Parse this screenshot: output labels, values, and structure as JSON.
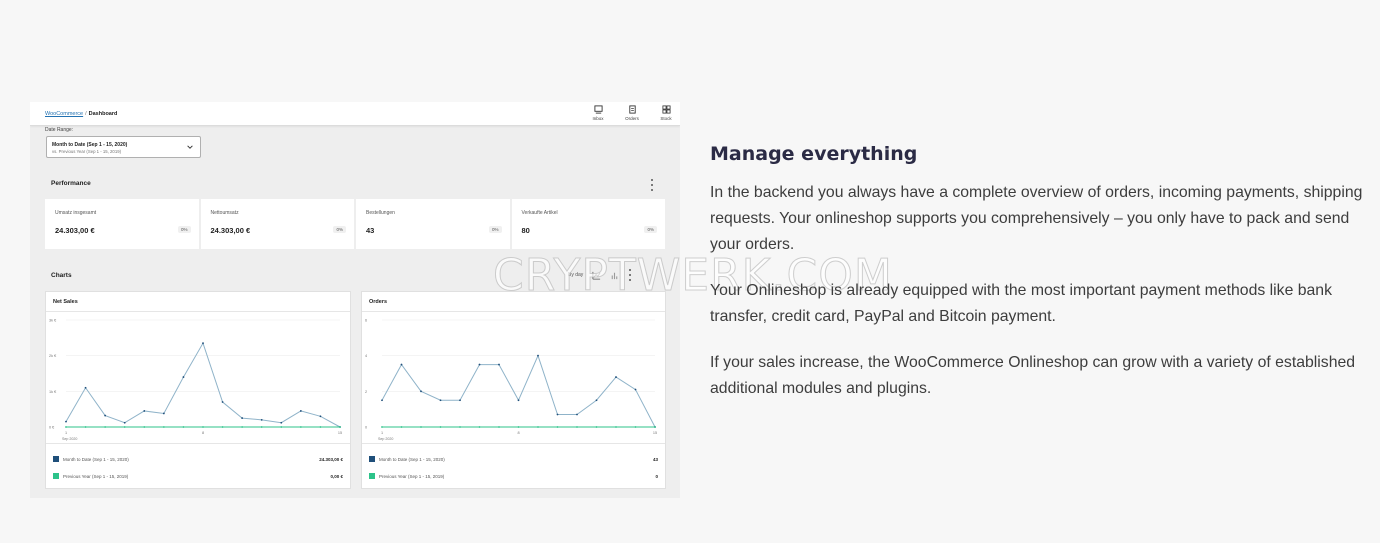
{
  "screenshot": {
    "breadcrumb": {
      "link": "WooCommerce",
      "separator": "/",
      "current": "Dashboard"
    },
    "topbar_items": [
      {
        "label": "Inbox",
        "icon": "inbox-icon"
      },
      {
        "label": "Orders",
        "icon": "orders-icon"
      },
      {
        "label": "Stock",
        "icon": "stock-icon"
      }
    ],
    "date_range": {
      "label": "Date Range:",
      "selected": "Month to Date (Sep 1 - 15, 2020)",
      "compare": "vs. Previous Year (Sep 1 - 15, 2019)"
    },
    "performance": {
      "title": "Performance",
      "cards": [
        {
          "label": "Umsatz insgesamt",
          "value": "24.303,00 €",
          "delta": "0%"
        },
        {
          "label": "Nettoumsatz",
          "value": "24.303,00 €",
          "delta": "0%"
        },
        {
          "label": "Bestellungen",
          "value": "43",
          "delta": "0%"
        },
        {
          "label": "Verkaufte Artikel",
          "value": "80",
          "delta": "0%"
        }
      ]
    },
    "charts_section": {
      "title": "Charts",
      "interval": "By day"
    },
    "colors": {
      "current": "#1f4f7a",
      "previous": "#2cc38a",
      "line": "#8fb3c9"
    }
  },
  "chart_data": [
    {
      "type": "line",
      "title": "Net Sales",
      "y_ticks": [
        "0 €",
        "1k €",
        "2k €",
        "3k €"
      ],
      "x_ticks": [
        "1",
        "8",
        "15"
      ],
      "x_sub": "Sep 2020",
      "ylim": [
        0,
        3000
      ],
      "x": [
        1,
        2,
        3,
        4,
        5,
        6,
        7,
        8,
        9,
        10,
        11,
        12,
        13,
        14,
        15
      ],
      "series": [
        {
          "name": "Month to Date (Sep 1 - 15, 2020)",
          "values": [
            150,
            1100,
            320,
            120,
            450,
            380,
            1400,
            2350,
            700,
            250,
            200,
            120,
            450,
            300,
            0
          ],
          "total": "24.303,00 €"
        },
        {
          "name": "Previous Year (Sep 1 - 15, 2019)",
          "values": [
            0,
            0,
            0,
            0,
            0,
            0,
            0,
            0,
            0,
            0,
            0,
            0,
            0,
            0,
            0
          ],
          "total": "0,00 €"
        }
      ]
    },
    {
      "type": "line",
      "title": "Orders",
      "y_ticks": [
        "0",
        "2",
        "4",
        "6"
      ],
      "x_ticks": [
        "1",
        "8",
        "15"
      ],
      "x_sub": "Sep 2020",
      "ylim": [
        0,
        6
      ],
      "x": [
        1,
        2,
        3,
        4,
        5,
        6,
        7,
        8,
        9,
        10,
        11,
        12,
        13,
        14,
        15
      ],
      "series": [
        {
          "name": "Month to Date (Sep 1 - 15, 2020)",
          "values": [
            1.5,
            3.5,
            2,
            1.5,
            1.5,
            3.5,
            3.5,
            1.5,
            4,
            0.7,
            0.7,
            1.5,
            2.8,
            2.1,
            0
          ],
          "total": "43"
        },
        {
          "name": "Previous Year (Sep 1 - 15, 2019)",
          "values": [
            0,
            0,
            0,
            0,
            0,
            0,
            0,
            0,
            0,
            0,
            0,
            0,
            0,
            0,
            0
          ],
          "total": "0"
        }
      ]
    }
  ],
  "watermark": "CRYPTWERK.COM",
  "content": {
    "heading": "Manage everything",
    "paragraphs": [
      "In the backend you always have a complete overview of orders, incoming payments, shipping requests. Your onlineshop supports you comprehensively – you only have to pack and send your orders.",
      "Your Onlineshop is already equipped with the most important payment methods like bank transfer, credit card, PayPal and Bitcoin payment.",
      "If your sales increase, the WooCommerce Onlineshop can grow with a variety of established additional modules and plugins."
    ]
  }
}
